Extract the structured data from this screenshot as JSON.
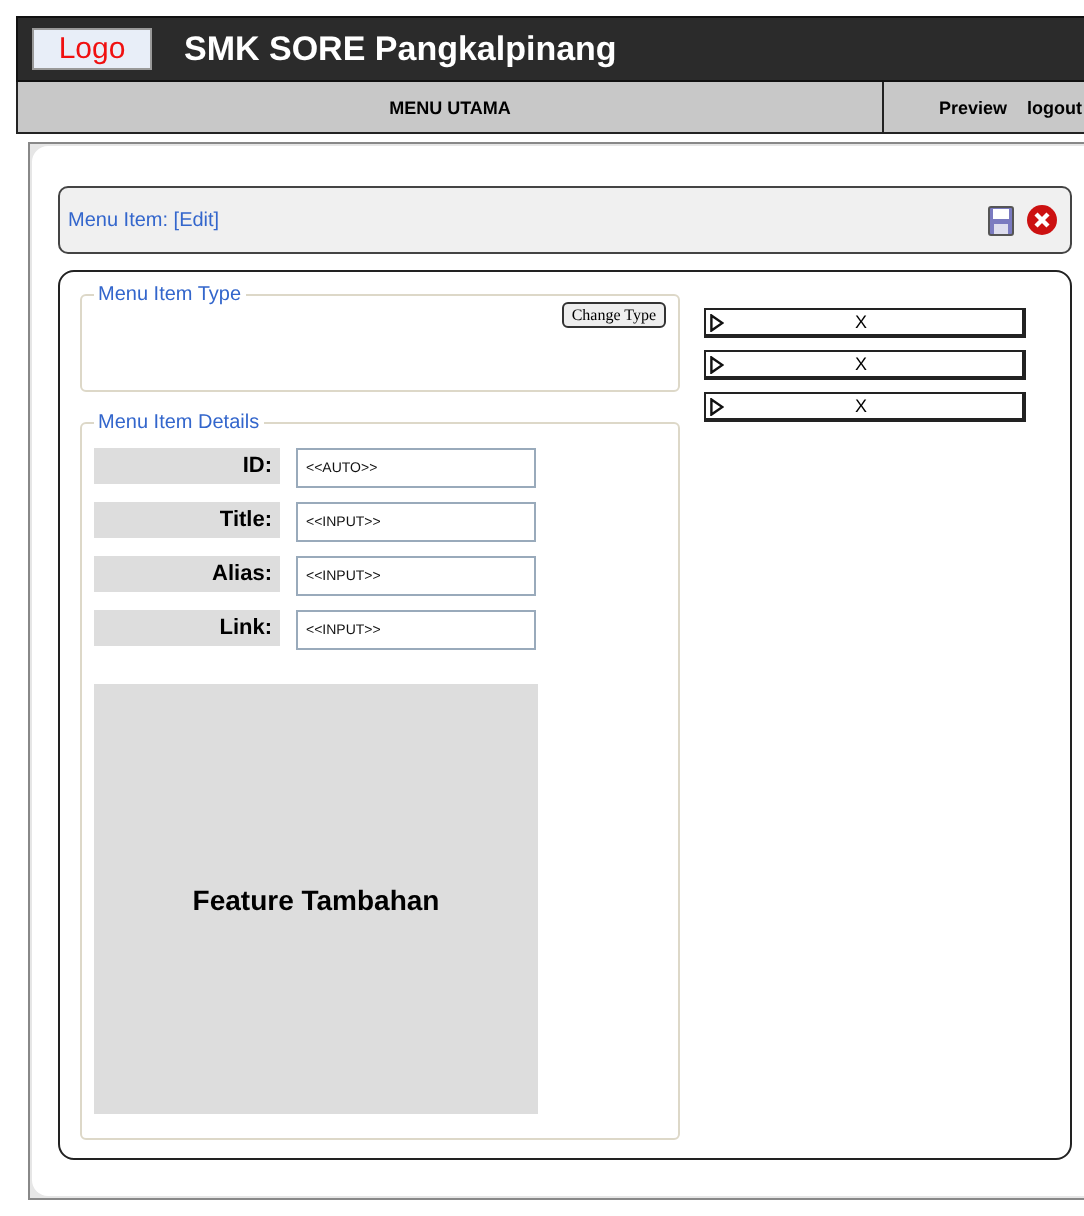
{
  "header": {
    "logo": "Logo",
    "title": "SMK SORE Pangkalpinang"
  },
  "nav": {
    "menu": "MENU UTAMA",
    "links": [
      "Preview",
      "logout"
    ]
  },
  "toolbar": {
    "title": "Menu Item: [Edit]"
  },
  "type_section": {
    "legend": "Menu Item Type",
    "button": "Change Type"
  },
  "details_section": {
    "legend": "Menu Item Details",
    "fields": [
      {
        "label": "ID:",
        "value": "<<AUTO>>"
      },
      {
        "label": "Title:",
        "value": "<<INPUT>>"
      },
      {
        "label": "Alias:",
        "value": "<<INPUT>>"
      },
      {
        "label": "Link:",
        "value": "<<INPUT>>"
      }
    ],
    "feature": "Feature Tambahan"
  },
  "side_panels": [
    {
      "label": "X"
    },
    {
      "label": "X"
    },
    {
      "label": "X"
    }
  ]
}
